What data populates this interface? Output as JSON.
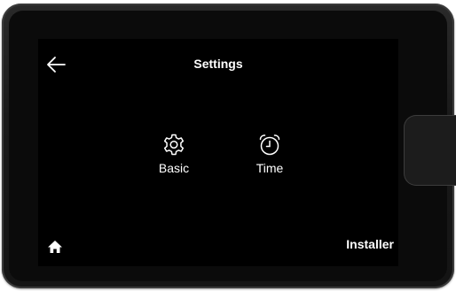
{
  "header": {
    "title": "Settings",
    "back_icon": "arrow-left-icon"
  },
  "menu": {
    "items": [
      {
        "label": "Basic",
        "icon": "gear-icon"
      },
      {
        "label": "Time",
        "icon": "alarm-clock-icon"
      }
    ]
  },
  "footer": {
    "home_icon": "home-icon",
    "installer_label": "Installer"
  },
  "colors": {
    "screen_background": "#000000",
    "text": "#ffffff",
    "device_frame": "#1a1a1a"
  }
}
